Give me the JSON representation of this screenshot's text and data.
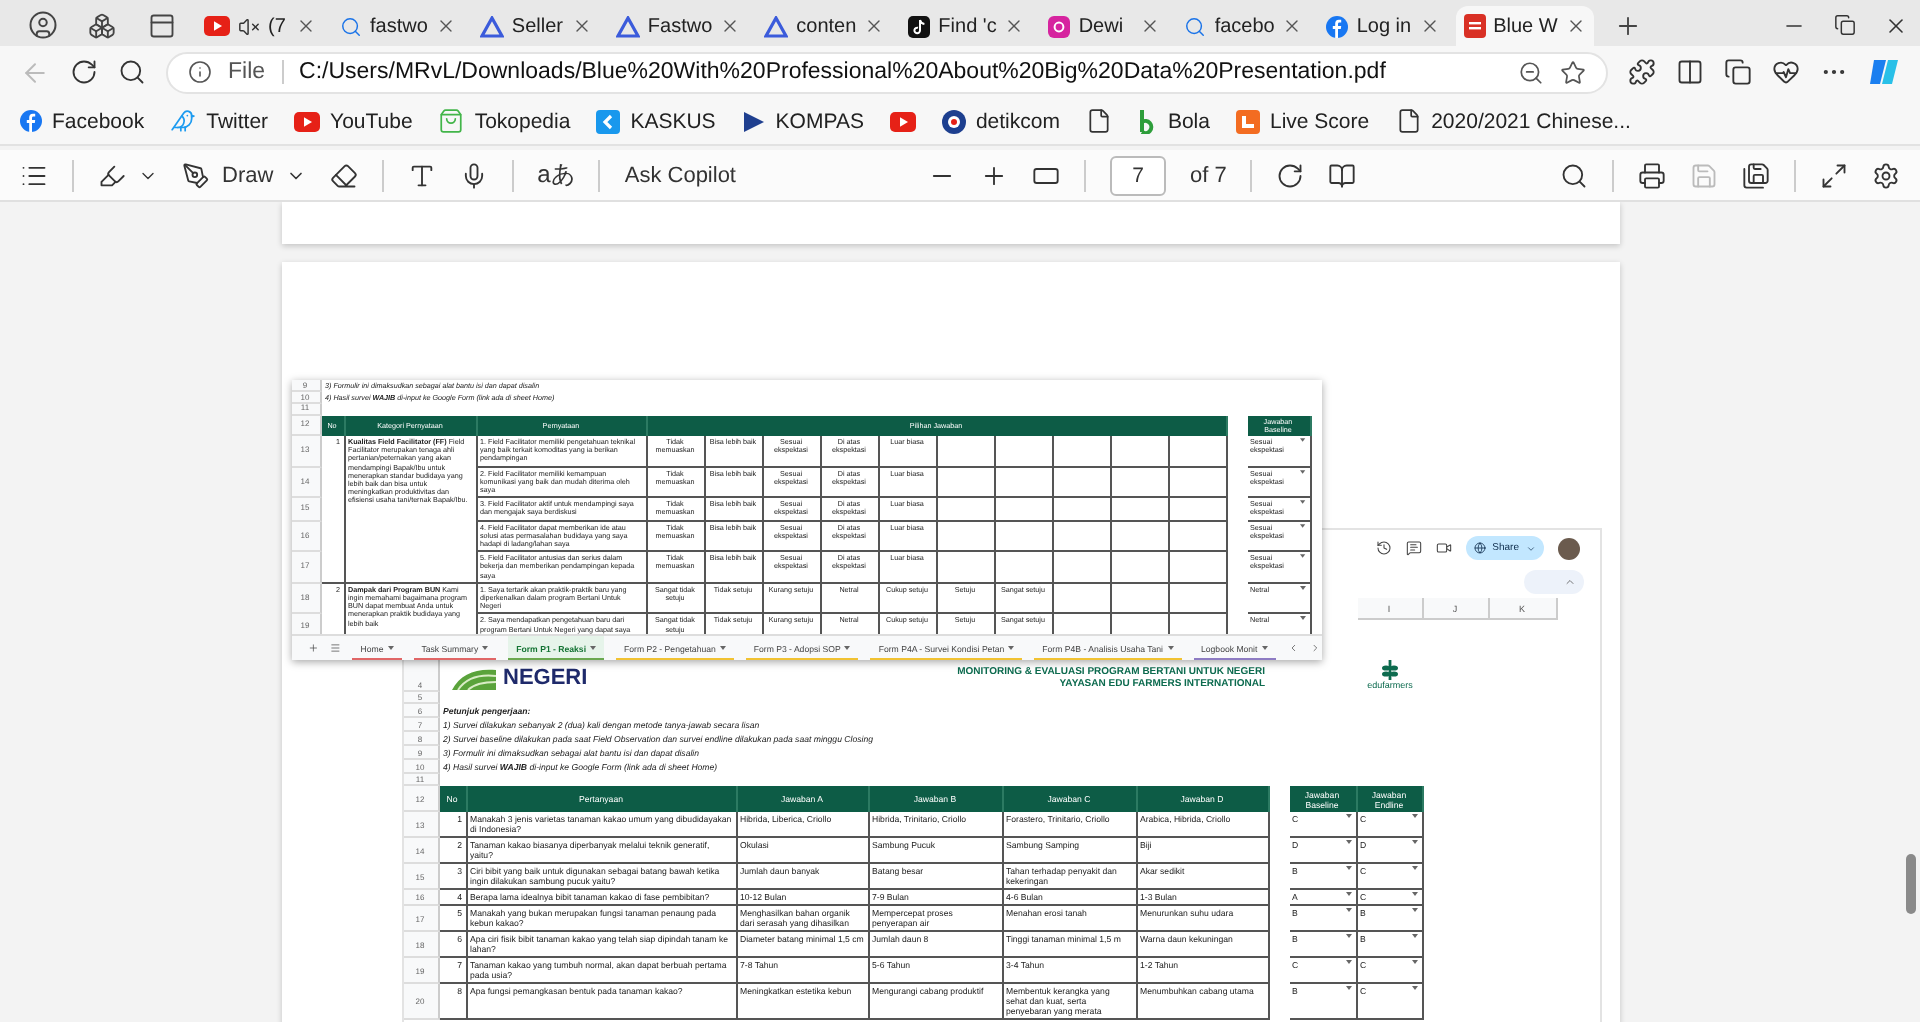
{
  "browser": {
    "tabs": [
      {
        "kind": "youtube",
        "label": "(7",
        "muted": true,
        "selected": false
      },
      {
        "kind": "search",
        "label": "fastwo",
        "selected": false
      },
      {
        "kind": "triangle",
        "label": "Seller",
        "selected": false
      },
      {
        "kind": "triangle",
        "label": "Fastwo",
        "selected": false
      },
      {
        "kind": "triangle",
        "label": "conten",
        "selected": false
      },
      {
        "kind": "tiktok",
        "label": "Find 'c",
        "selected": false
      },
      {
        "kind": "instagram",
        "label": "Dewi",
        "selected": false
      },
      {
        "kind": "search",
        "label": "facebo",
        "selected": false
      },
      {
        "kind": "facebook",
        "label": "Log in",
        "selected": false
      },
      {
        "kind": "pdf",
        "label": "Blue W",
        "selected": true
      }
    ],
    "address": {
      "scheme": "File",
      "url": "C:/Users/MRvL/Downloads/Blue%20With%20Professional%20About%20Big%20Data%20Presentation.pdf"
    },
    "bookmarks": [
      {
        "kind": "facebook",
        "label": "Facebook"
      },
      {
        "kind": "twitter",
        "label": "Twitter"
      },
      {
        "kind": "youtube",
        "label": "YouTube"
      },
      {
        "kind": "tokopedia",
        "label": "Tokopedia"
      },
      {
        "kind": "kaskus",
        "label": "KASKUS"
      },
      {
        "kind": "kompas",
        "label": "KOMPAS"
      },
      {
        "kind": "youtube"
      },
      {
        "kind": "detik",
        "label": "detikcom"
      },
      {
        "kind": "page"
      },
      {
        "kind": "bola",
        "label": "Bola"
      },
      {
        "kind": "livescore",
        "label": "Live Score"
      },
      {
        "kind": "page",
        "label": "2020/2021 Chinese..."
      }
    ]
  },
  "pdf_toolbar": {
    "draw": "Draw",
    "translate": "aあ",
    "ask": "Ask Copilot",
    "page": "7",
    "page_count": "of 7"
  },
  "sheet": {
    "share": "Share",
    "columns": [
      "I",
      "J",
      "K"
    ],
    "logo": "NEGERI",
    "title": "MONITORING & EVALUASI PROGRAM BERTANI UNTUK NEGERI",
    "subtitle": "YAYASAN EDU FARMERS INTERNATIONAL",
    "brand": "edufarmers",
    "logo_row": "4",
    "info_rows": [
      {
        "num": "5"
      },
      {
        "num": "6",
        "kind": "heading",
        "text": "Petunjuk pengerjaan:"
      },
      {
        "num": "7",
        "kind": "note",
        "text": "1) Survei dilakukan sebanyak 2 (dua) kali dengan metode tanya-jawab secara lisan"
      },
      {
        "num": "8",
        "kind": "note",
        "text": "2) Survei baseline dilakukan pada saat Field Observation dan survei endline dilakukan pada saat minggu Closing"
      },
      {
        "num": "9",
        "kind": "note",
        "text": "3) Formulir ini dimaksudkan sebagai alat bantu isi dan dapat disalin"
      },
      {
        "num": "10",
        "kind": "note",
        "text": "4) Hasil survei **WAJIB** di-input ke Google Form (link ada di sheet Home)"
      },
      {
        "num": "11"
      }
    ],
    "header": {
      "num": "12",
      "cells": [
        "No",
        "Pertanyaan",
        "Jawaban A",
        "Jawaban B",
        "Jawaban C",
        "Jawaban D",
        "Jawaban Baseline",
        "Jawaban Endline"
      ]
    },
    "rows": [
      {
        "num": "13",
        "no": "1",
        "question": "Manakah 3 jenis varietas tanaman kakao umum yang dibudidayakan di Indonesia?",
        "answers": [
          "Hibrida, Liberica, Criollo",
          "Hibrida, Trinitario, Criollo",
          "Forastero, Trinitario, Criollo",
          "Arabica, Hibrida, Criollo"
        ],
        "baseline": "C",
        "endline": "C"
      },
      {
        "num": "14",
        "no": "2",
        "question": "Tanaman kakao biasanya diperbanyak melalui teknik generatif, yaitu?",
        "answers": [
          "Okulasi",
          "Sambung Pucuk",
          "Sambung Samping",
          "Biji"
        ],
        "baseline": "D",
        "endline": "D"
      },
      {
        "num": "15",
        "no": "3",
        "question": "Ciri bibit yang baik untuk digunakan sebagai batang bawah ketika ingin dilakukan sambung pucuk yaitu?",
        "answers": [
          "Jumlah daun banyak",
          "Batang besar",
          "Tahan terhadap penyakit dan kekeringan",
          "Akar sedikit"
        ],
        "baseline": "B",
        "endline": "C"
      },
      {
        "num": "16",
        "no": "4",
        "question": "Berapa lama idealnya bibit tanaman kakao di fase pembibitan?",
        "answers": [
          "10-12 Bulan",
          "7-9 Bulan",
          "4-6 Bulan",
          "1-3 Bulan"
        ],
        "baseline": "A",
        "endline": "C"
      },
      {
        "num": "17",
        "no": "5",
        "question": "Manakah yang bukan merupakan fungsi tanaman penaung pada kebun kakao?",
        "answers": [
          "Menghasilkan bahan organik dari serasah yang dihasilkan",
          "Mempercepat proses penyerapan air",
          "Menahan erosi tanah",
          "Menurunkan suhu udara"
        ],
        "baseline": "B",
        "endline": "B"
      },
      {
        "num": "18",
        "no": "6",
        "question": "Apa ciri fisik bibit tanaman kakao yang telah siap dipindah tanam ke lahan?",
        "answers": [
          "Diameter batang minimal 1,5 cm",
          "Jumlah daun 8",
          "Tinggi tanaman minimal 1,5 m",
          "Warna daun kekuningan"
        ],
        "baseline": "B",
        "endline": "B"
      },
      {
        "num": "19",
        "no": "7",
        "question": "Tanaman kakao yang tumbuh normal, akan dapat berbuah pertama pada usia?",
        "answers": [
          "7-8 Tahun",
          "5-6 Tahun",
          "3-4 Tahun",
          "1-2 Tahun"
        ],
        "baseline": "C",
        "endline": "C"
      },
      {
        "num": "20",
        "no": "8",
        "question": "Apa fungsi pemangkasan bentuk pada tanaman kakao?",
        "answers": [
          "Meningkatkan estetika kebun",
          "Mengurangi cabang produktif",
          "Membentuk kerangka yang sehat dan kuat, serta penyebaran yang merata",
          "Menumbuhkan cabang utama"
        ],
        "baseline": "B",
        "endline": "C"
      }
    ]
  },
  "overlay": {
    "notes": [
      {
        "num": "9",
        "text": "3) Formulir ini dimaksudkan sebagai alat bantu isi dan dapat disalin"
      },
      {
        "num": "10",
        "text": "4) Hasil survei **WAJIB** di-input ke Google Form (link ada di sheet Home)"
      }
    ],
    "blank_num": "11",
    "header": {
      "num": "12",
      "cells": [
        "No",
        "Kategori Pernyataan",
        "Pernyataan",
        "Pilihan Jawaban",
        "Jawaban Baseline"
      ]
    },
    "groups": [
      {
        "no": "1",
        "category": "**Kualitas Field Facilitator (FF)** Field Facilitator merupakan tenaga ahli pertanian/peternakan yang akan mendampingi Bapak/Ibu untuk menerapkan standar budidaya yang lebih baik dan bisa untuk meningkatkan produktivitas dan efisiensi usaha tani/ternak Bapak/Ibu.",
        "rows": [
          {
            "num": "13",
            "statement": "1. Field Facilitator memiliki pengetahuan teknikal yang baik terkait komoditas yang ia berikan pendampingan",
            "options": [
              "Tidak memuaskan",
              "Bisa lebih baik",
              "Sesuai ekspektasi",
              "Di atas ekspektasi",
              "Luar biasa"
            ],
            "baseline": "Sesuai ekspektasi"
          },
          {
            "num": "14",
            "statement": "2. Field Facilitator memiliki kemampuan komunikasi yang baik dan mudah diterima oleh saya",
            "options": [
              "Tidak memuaskan",
              "Bisa lebih baik",
              "Sesuai ekspektasi",
              "Di atas ekspektasi",
              "Luar biasa"
            ],
            "baseline": "Sesuai ekspektasi"
          },
          {
            "num": "15",
            "statement": "3. Field Facilitator aktif untuk mendampingi saya dan mengajak saya berdiskusi",
            "options": [
              "Tidak memuaskan",
              "Bisa lebih baik",
              "Sesuai ekspektasi",
              "Di atas ekspektasi",
              "Luar biasa"
            ],
            "baseline": "Sesuai ekspektasi"
          },
          {
            "num": "16",
            "statement": "4. Field Facilitator dapat memberikan ide atau solusi atas permasalahan budidaya yang saya hadapi di ladang/lahan saya",
            "options": [
              "Tidak memuaskan",
              "Bisa lebih baik",
              "Sesuai ekspektasi",
              "Di atas ekspektasi",
              "Luar biasa"
            ],
            "baseline": "Sesuai ekspektasi"
          },
          {
            "num": "17",
            "statement": "5. Field Facilitator antusias dan serius dalam bekerja dan memberikan pendampingan kepada saya",
            "options": [
              "Tidak memuaskan",
              "Bisa lebih baik",
              "Sesuai ekspektasi",
              "Di atas ekspektasi",
              "Luar biasa"
            ],
            "baseline": "Sesuai ekspektasi"
          }
        ]
      },
      {
        "no": "2",
        "category": "**Dampak dari Program BUN** Kami ingin memahami bagaimana program BUN dapat membuat Anda untuk menerapkan praktik budidaya yang lebih baik",
        "rows": [
          {
            "num": "18",
            "statement": "1. Saya tertarik akan praktik-praktik baru yang diperkenalkan dalam program Bertani Untuk Negeri",
            "options": [
              "Sangat tidak setuju",
              "Tidak setuju",
              "Kurang setuju",
              "Netral",
              "Cukup setuju",
              "Setuju",
              "Sangat setuju"
            ],
            "baseline": "Netral"
          },
          {
            "num": "19",
            "statement": "2. Saya mendapatkan pengetahuan baru dari program Bertani Untuk Negeri yang dapat saya",
            "options": [
              "Sangat tidak setuju",
              "Tidak setuju",
              "Kurang setuju",
              "Netral",
              "Cukup setuju",
              "Setuju",
              "Sangat setuju"
            ],
            "baseline": "Netral"
          }
        ]
      }
    ],
    "tabs": [
      {
        "label": "Home",
        "selected": false,
        "color": "#e06666"
      },
      {
        "label": "Task Summary",
        "selected": false,
        "color": "#e06666"
      },
      {
        "label": "Form P1 - Reaksi",
        "selected": true,
        "color": "#6aa84f"
      },
      {
        "label": "Form P2 - Pengetahuan",
        "selected": false,
        "color": "#f1c232"
      },
      {
        "label": "Form P3 - Adopsi SOP",
        "selected": false,
        "color": "#f1c232"
      },
      {
        "label": "Form P4A - Survei Kondisi Petan",
        "selected": false,
        "color": "#f1c232"
      },
      {
        "label": "Form P4B - Analisis Usaha Tani",
        "selected": false,
        "color": "#f1c232"
      },
      {
        "label": "Logbook Monit",
        "selected": false,
        "color": "#8e7cc3"
      }
    ]
  }
}
